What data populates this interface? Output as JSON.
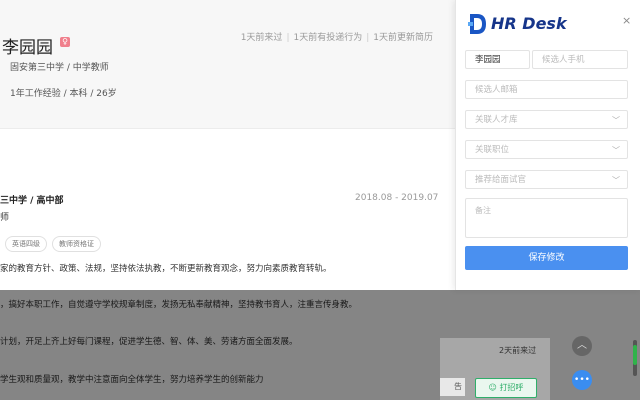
{
  "profile": {
    "name": "李园园",
    "gender_badge": "♀",
    "job": "固安第三中学 / 中学教师",
    "info": "1年工作经验 / 本科 / 26岁",
    "activity": [
      "1天前来过",
      "1天前有投递行为",
      "1天前更新简历"
    ]
  },
  "work": {
    "title": "三中学 / 高中部",
    "date": "2018.08 - 2019.07",
    "role": "师",
    "tags": [
      "英语四级",
      "教师资格证"
    ],
    "descriptions": [
      "家的教育方针、政策、法规，坚持依法执教，不断更新教育观念，努力向素质教育转轨。",
      "，搞好本职工作，自觉遵守学校规章制度，发扬无私奉献精神，坚持教书育人，注重言传身教。",
      "计划，开足上齐上好每门课程，促进学生德、智、体、美、劳诸方面全面发展。",
      "学生观和质量观，教学中注意面向全体学生，努力培养学生的创新能力"
    ]
  },
  "bottom": {
    "time": "2天前来过",
    "left_button": "告",
    "chat_button": "打招呼"
  },
  "panel": {
    "brand": "HR Desk",
    "close": "×",
    "name_value": "李园园",
    "phone_placeholder": "候选人手机",
    "email_placeholder": "候选人邮箱",
    "talent_pool_placeholder": "关联人才库",
    "position_placeholder": "关联职位",
    "interviewer_placeholder": "推荐给面试官",
    "note_placeholder": "备注",
    "save_label": "保存修改"
  },
  "colors": {
    "brand": "#16358a",
    "save_button": "#4a90f0",
    "chat_green": "#2fae6a"
  }
}
